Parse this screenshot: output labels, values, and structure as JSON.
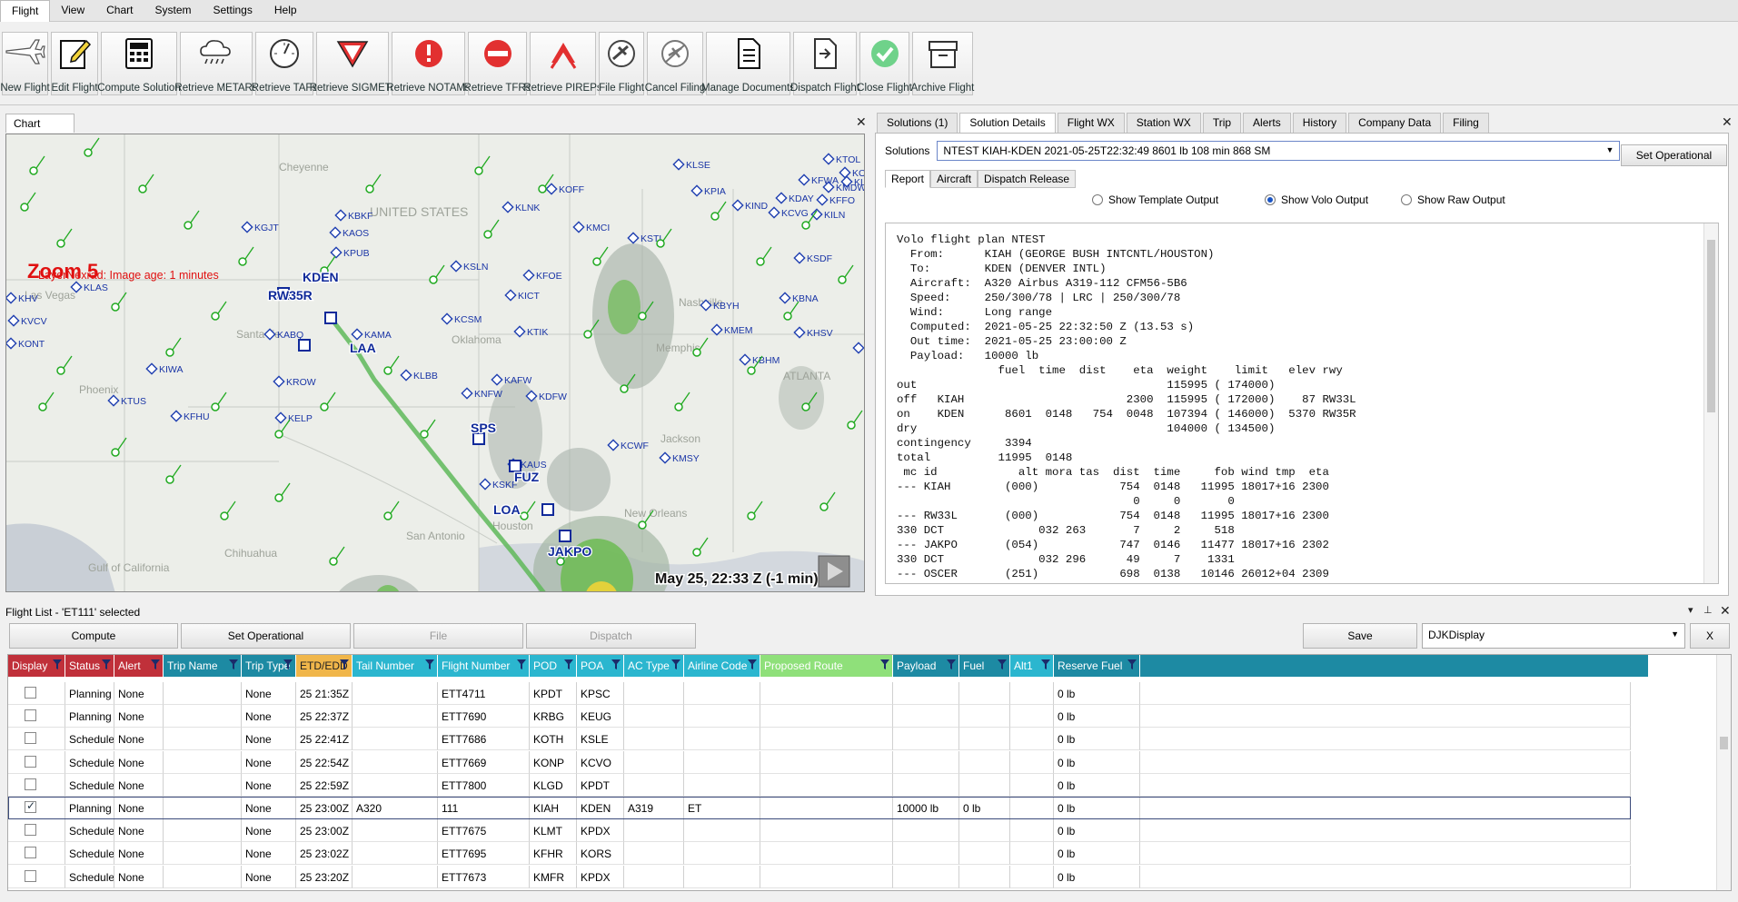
{
  "menu": [
    "Flight",
    "View",
    "Chart",
    "System",
    "Settings",
    "Help"
  ],
  "toolbar": [
    {
      "label": "New Flight",
      "icon": "airplane-icon"
    },
    {
      "label": "Edit Flight",
      "icon": "edit-icon"
    },
    {
      "label": "Compute Solution",
      "icon": "calculator-icon"
    },
    {
      "label": "Retrieve METARs",
      "icon": "cloud-rain-icon"
    },
    {
      "label": "Retrieve TAFs",
      "icon": "gauge-icon"
    },
    {
      "label": "Retrieve SIGMETs",
      "icon": "triangle-warning-icon"
    },
    {
      "label": "Retrieve NOTAMs",
      "icon": "alert-circle-icon"
    },
    {
      "label": "Retrieve TFRs",
      "icon": "no-entry-icon"
    },
    {
      "label": "Retrieve PIREPs",
      "icon": "pirep-chevron-icon"
    },
    {
      "label": "File Flight",
      "icon": "plane-circle-icon"
    },
    {
      "label": "Cancel Filing",
      "icon": "plane-cancel-icon"
    },
    {
      "label": "Manage Documents",
      "icon": "document-icon"
    },
    {
      "label": "Dispatch Flight",
      "icon": "dispatch-icon"
    },
    {
      "label": "Close Flight",
      "icon": "check-circle-icon"
    },
    {
      "label": "Archive Flight",
      "icon": "archive-icon"
    }
  ],
  "chart": {
    "tab_label": "Chart",
    "zoom": "Zoom 5",
    "layer": "LayerNexrad:  Image age:  1 minutes",
    "timestamp": "May 25, 22:33 Z  (-1 min)",
    "region_labels": [
      "UNITED STATES",
      "Cheyenne",
      "Las Vegas",
      "Santa Fe",
      "Phoenix",
      "Oklahoma",
      "Memphis",
      "ATLANTA",
      "Nashville",
      "Jackson",
      "Houston",
      "San Antonio",
      "Chihuahua",
      "Gulf of California",
      "New Orleans"
    ],
    "route_points": [
      {
        "name": "KDEN"
      },
      {
        "name": "RW35R"
      },
      {
        "name": "LAA"
      },
      {
        "name": "SPS"
      },
      {
        "name": "FUZ"
      },
      {
        "name": "LOA"
      },
      {
        "name": "JAKPO"
      }
    ],
    "stations": [
      "KTOL",
      "KORD",
      "KLCI",
      "KMDW",
      "KLSE",
      "KOFF",
      "KFWA",
      "KPIA",
      "KFFO",
      "KIND",
      "KDAY",
      "KILN",
      "KCVG",
      "KLNK",
      "KMCI",
      "KSTL",
      "KSDF",
      "KBKF",
      "KGJT",
      "KAOS",
      "KPUB",
      "KICT",
      "KSLN",
      "KFOE",
      "KBNA",
      "KBYH",
      "KLAS",
      "KVCV",
      "KABQ",
      "KAMA",
      "KCSM",
      "KTIK",
      "KMEM",
      "KHSV",
      "KBHM",
      "KATL",
      "KIWA",
      "KROW",
      "KLBB",
      "KAFW",
      "KNFW",
      "KDFW",
      "KTUS",
      "KFHU",
      "KELP",
      "KCWF",
      "KAUS",
      "KSKF",
      "KMSY",
      "KRB",
      "KHV",
      "KONT",
      "KBOF"
    ]
  },
  "right_panel": {
    "tabs": [
      "Solutions (1)",
      "Solution Details",
      "Flight WX",
      "Station WX",
      "Trip",
      "Alerts",
      "History",
      "Company Data",
      "Filing"
    ],
    "active_tab": "Solution Details",
    "solutions_label": "Solutions",
    "solution_value": "NTEST KIAH-KDEN 2021-05-25T22:32:49 8601 lb 108 min 868 SM",
    "set_operational": "Set Operational",
    "subtabs": [
      "Report",
      "Aircraft",
      "Dispatch Release"
    ],
    "radios": [
      {
        "label": "Show Template Output",
        "checked": false
      },
      {
        "label": "Show Volo Output",
        "checked": true
      },
      {
        "label": "Show Raw Output",
        "checked": false
      }
    ],
    "report_lines": [
      "Volo flight plan NTEST",
      "  From:      KIAH (GEORGE BUSH INTCNTL/HOUSTON)",
      "  To:        KDEN (DENVER INTL)",
      "  Aircraft:  A320 Airbus A319-112 CFM56-5B6",
      "  Speed:     250/300/78 | LRC | 250/300/78",
      "  Wind:      Long range",
      "  Computed:  2021-05-25 22:32:50 Z (13.53 s)",
      "  Out time:  2021-05-25 23:00:00 Z",
      "  Payload:   10000 lb",
      "               fuel  time  dist    eta  weight    limit   elev rwy",
      "out                                     115995 ( 174000)",
      "off   KIAH                        2300  115995 ( 172000)    87 RW33L",
      "on    KDEN      8601  0148   754  0048  107394 ( 146000)  5370 RW35R",
      "dry                                     104000 ( 134500)",
      "contingency     3394",
      "total          11995  0148",
      " mc id            alt mora tas  dist  time     fob wind tmp  eta",
      "--- KIAH        (000)            754  0148   11995 18017+16 2300",
      "                                   0     0       0",
      "--- RW33L       (000)            754  0148   11995 18017+16 2300",
      "330 DCT              032 263       7     2     518",
      "--- JAKPO       (054)            747  0146   11477 18017+16 2302",
      "330 DCT              032 296      49     7    1331",
      "--- OSCER       (251)            698  0138   10146 26012+04 2309",
      "342 DCT              032 362      31     3     435"
    ]
  },
  "flight_list": {
    "title": "Flight List - 'ET111' selected",
    "buttons": {
      "compute": "Compute",
      "set_operational": "Set Operational",
      "file": "File",
      "dispatch": "Dispatch",
      "save": "Save",
      "close": "X"
    },
    "display_select": "DJKDisplay",
    "columns": [
      {
        "label": "Display",
        "color": "#c0303a"
      },
      {
        "label": "Status",
        "color": "#c0303a"
      },
      {
        "label": "Alert",
        "color": "#c0303a"
      },
      {
        "label": "Trip Name",
        "color": "#1d8aa3"
      },
      {
        "label": "Trip Type",
        "color": "#1d8aa3"
      },
      {
        "label": "ETD/EDD",
        "color": "#f0b64a"
      },
      {
        "label": "Tail Number",
        "color": "#2bb6cf"
      },
      {
        "label": "Flight Number",
        "color": "#2bb6cf"
      },
      {
        "label": "POD",
        "color": "#2bb6cf"
      },
      {
        "label": "POA",
        "color": "#2bb6cf"
      },
      {
        "label": "AC Type",
        "color": "#2bb6cf"
      },
      {
        "label": "Airline Code",
        "color": "#2bb6cf"
      },
      {
        "label": "Proposed Route",
        "color": "#8fe07a"
      },
      {
        "label": "Payload",
        "color": "#1d8aa3"
      },
      {
        "label": "Fuel",
        "color": "#1d8aa3"
      },
      {
        "label": "Alt1",
        "color": "#2bb6cf"
      },
      {
        "label": "Reserve Fuel",
        "color": "#1d8aa3"
      }
    ],
    "rows": [
      {
        "checked": false,
        "status": "Planning",
        "alert": "None",
        "trip_type": "None",
        "etd": "25 21:35Z",
        "tail": "",
        "flight": "ETT4711",
        "pod": "KPDT",
        "poa": "KPSC",
        "ac": "",
        "airline": "",
        "payload": "",
        "fuel": "",
        "reserve": "0 lb"
      },
      {
        "checked": false,
        "status": "Planning",
        "alert": "None",
        "trip_type": "None",
        "etd": "25 22:37Z",
        "tail": "",
        "flight": "ETT7690",
        "pod": "KRBG",
        "poa": "KEUG",
        "ac": "",
        "airline": "",
        "payload": "",
        "fuel": "",
        "reserve": "0 lb"
      },
      {
        "checked": false,
        "status": "Scheduled",
        "alert": "None",
        "trip_type": "None",
        "etd": "25 22:41Z",
        "tail": "",
        "flight": "ETT7686",
        "pod": "KOTH",
        "poa": "KSLE",
        "ac": "",
        "airline": "",
        "payload": "",
        "fuel": "",
        "reserve": "0 lb"
      },
      {
        "checked": false,
        "status": "Scheduled",
        "alert": "None",
        "trip_type": "None",
        "etd": "25 22:54Z",
        "tail": "",
        "flight": "ETT7669",
        "pod": "KONP",
        "poa": "KCVO",
        "ac": "",
        "airline": "",
        "payload": "",
        "fuel": "",
        "reserve": "0 lb"
      },
      {
        "checked": false,
        "status": "Scheduled",
        "alert": "None",
        "trip_type": "None",
        "etd": "25 22:59Z",
        "tail": "",
        "flight": "ETT7800",
        "pod": "KLGD",
        "poa": "KPDT",
        "ac": "",
        "airline": "",
        "payload": "",
        "fuel": "",
        "reserve": "0 lb"
      },
      {
        "checked": true,
        "status": "Planning",
        "alert": "None",
        "trip_type": "None",
        "etd": "25 23:00Z",
        "tail": "A320",
        "flight": "111",
        "pod": "KIAH",
        "poa": "KDEN",
        "ac": "A319",
        "airline": "ET",
        "payload": "10000 lb",
        "fuel": "0 lb",
        "reserve": "0 lb"
      },
      {
        "checked": false,
        "status": "Scheduled",
        "alert": "None",
        "trip_type": "None",
        "etd": "25 23:00Z",
        "tail": "",
        "flight": "ETT7675",
        "pod": "KLMT",
        "poa": "KPDX",
        "ac": "",
        "airline": "",
        "payload": "",
        "fuel": "",
        "reserve": "0 lb"
      },
      {
        "checked": false,
        "status": "Scheduled",
        "alert": "None",
        "trip_type": "None",
        "etd": "25 23:02Z",
        "tail": "",
        "flight": "ETT7695",
        "pod": "KFHR",
        "poa": "KORS",
        "ac": "",
        "airline": "",
        "payload": "",
        "fuel": "",
        "reserve": "0 lb"
      },
      {
        "checked": false,
        "status": "Scheduled",
        "alert": "None",
        "trip_type": "None",
        "etd": "25 23:20Z",
        "tail": "",
        "flight": "ETT7673",
        "pod": "KMFR",
        "poa": "KPDX",
        "ac": "",
        "airline": "",
        "payload": "",
        "fuel": "",
        "reserve": "0 lb"
      }
    ]
  }
}
